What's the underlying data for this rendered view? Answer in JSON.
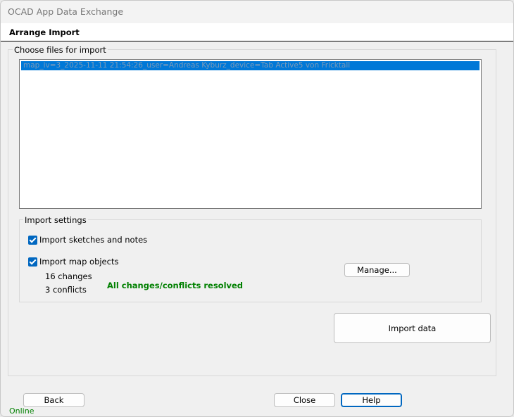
{
  "window": {
    "title": "OCAD App Data Exchange"
  },
  "header": {
    "title": "Arrange Import"
  },
  "files": {
    "legend": "Choose files for import",
    "items": [
      {
        "label": "map_iv=3_2025-11-11 21:54:26_user=Andreas Kyburz_device=Tab Active5 von Fricktall",
        "selected": true
      }
    ]
  },
  "import_settings": {
    "legend": "Import settings",
    "sketches_label": "Import sketches and notes",
    "sketches_checked": true,
    "map_objects_label": "Import map objects",
    "map_objects_checked": true,
    "changes_text": "16 changes",
    "conflicts_text": "3 conflicts",
    "resolved_text": "All changes/conflicts resolved",
    "manage_label": "Manage..."
  },
  "actions": {
    "import_label": "Import data"
  },
  "footer": {
    "back_label": "Back",
    "close_label": "Close",
    "help_label": "Help",
    "status": "Online"
  },
  "colors": {
    "accent": "#0067c0",
    "selection": "#0078d7",
    "success": "#008000"
  }
}
